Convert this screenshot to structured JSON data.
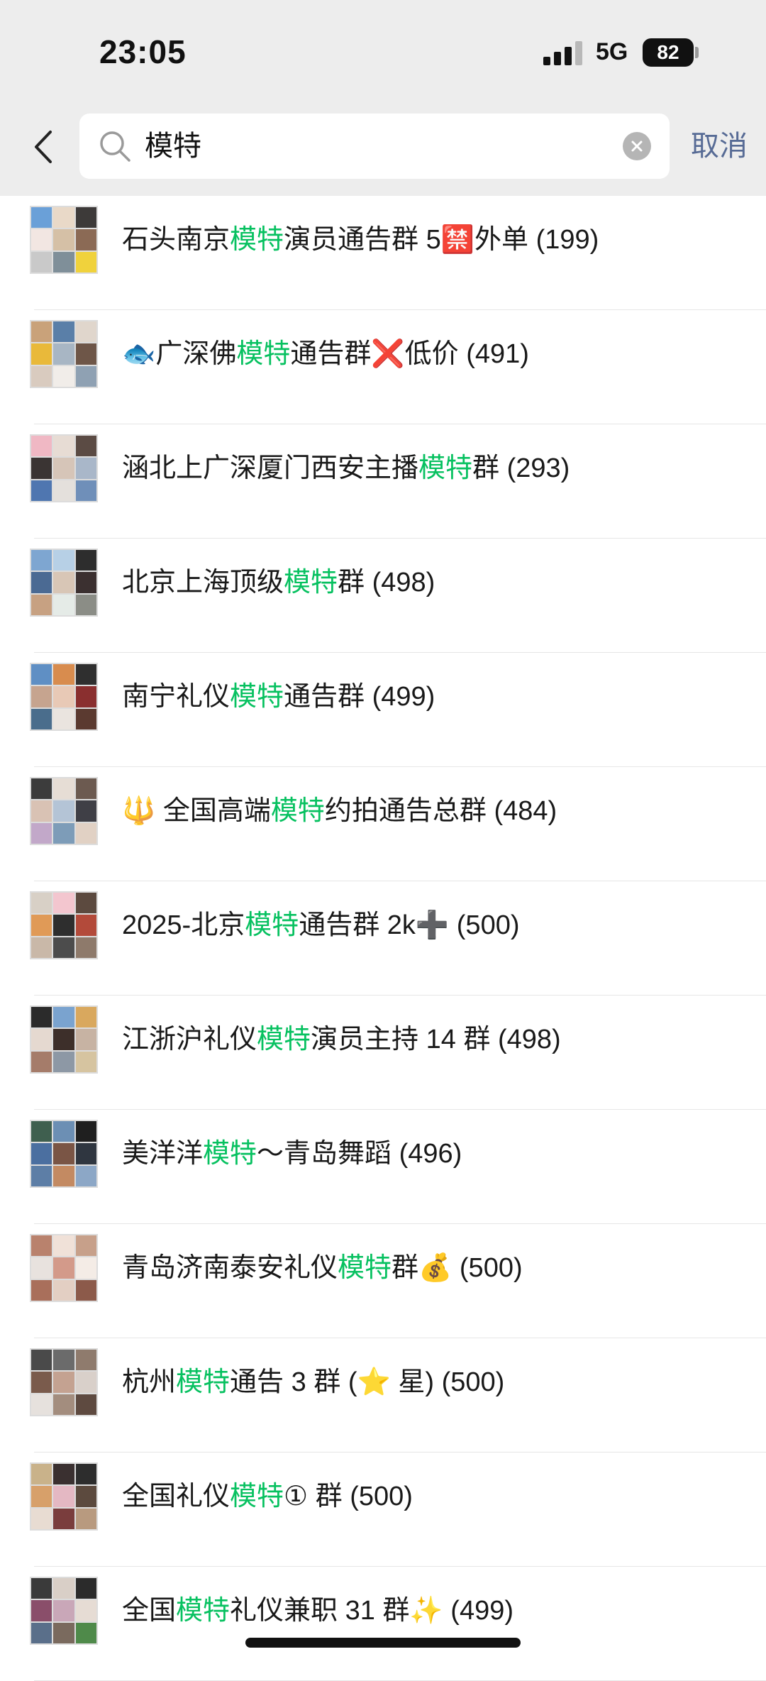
{
  "status_bar": {
    "time": "23:05",
    "network": "5G",
    "battery": "82"
  },
  "search": {
    "query": "模特",
    "cancel_label": "取消"
  },
  "colors": {
    "highlight": "#07c160",
    "link": "#576b95"
  },
  "icons": {
    "back": "chevron-left-icon",
    "search": "search-icon",
    "clear": "clear-icon"
  },
  "results": [
    {
      "before": "石头南京",
      "keyword": "模特",
      "after": "演员通告群 5🈲外单 (199)"
    },
    {
      "before": "🐟广深佛",
      "keyword": "模特",
      "after": "通告群❌低价 (491)"
    },
    {
      "before": "涵北上广深厦门西安主播",
      "keyword": "模特",
      "after": "群 (293)"
    },
    {
      "before": "北京上海顶级",
      "keyword": "模特",
      "after": "群 (498)"
    },
    {
      "before": "南宁礼仪",
      "keyword": "模特",
      "after": "通告群 (499)"
    },
    {
      "before": "🔱 全国高端",
      "keyword": "模特",
      "after": "约拍通告总群 (484)"
    },
    {
      "before": "2025-北京",
      "keyword": "模特",
      "after": "通告群 2k➕ (500)"
    },
    {
      "before": "江浙沪礼仪",
      "keyword": "模特",
      "after": "演员主持 14 群 (498)"
    },
    {
      "before": "美洋洋",
      "keyword": "模特",
      "after": "～青岛舞蹈 (496)"
    },
    {
      "before": "青岛济南泰安礼仪",
      "keyword": "模特",
      "after": "群💰 (500)"
    },
    {
      "before": "杭州",
      "keyword": "模特",
      "after": "通告 3 群 (⭐ 星) (500)"
    },
    {
      "before": "全国礼仪",
      "keyword": "模特",
      "after": "① 群 (500)"
    },
    {
      "before": "全国",
      "keyword": "模特",
      "after": "礼仪兼职 31 群✨ (499)"
    }
  ]
}
